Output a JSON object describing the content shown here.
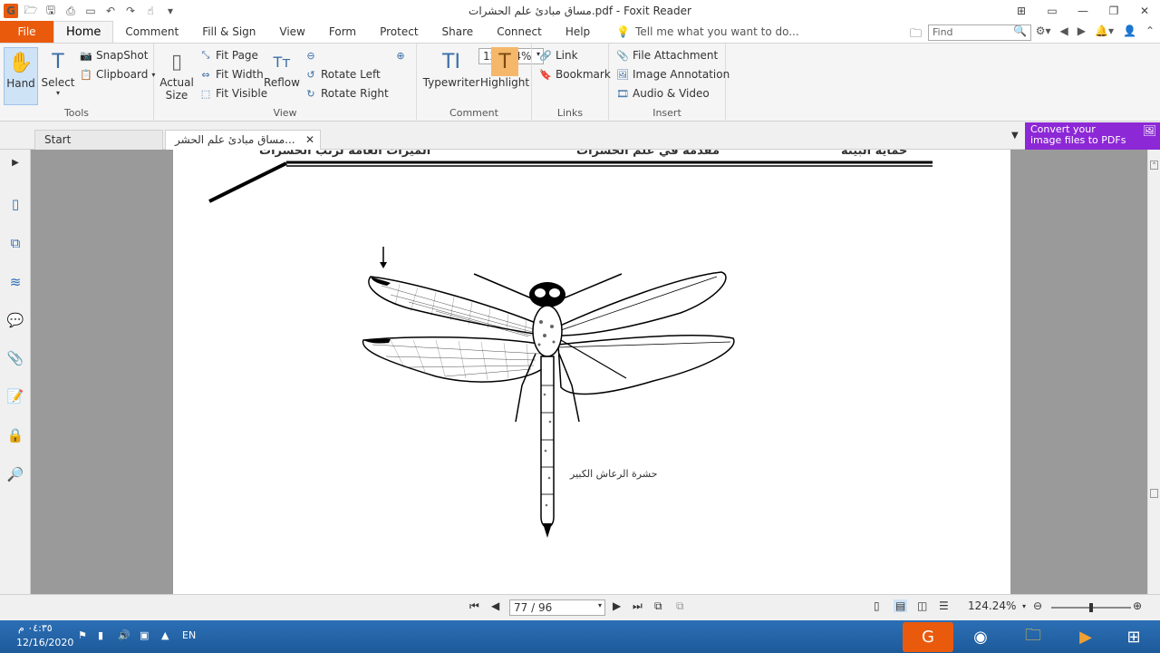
{
  "window": {
    "title": "مساق مبادئ علم الحشرات.pdf - Foxit Reader"
  },
  "menu": {
    "file": "File",
    "tabs": [
      "Home",
      "Comment",
      "Fill & Sign",
      "View",
      "Form",
      "Protect",
      "Share",
      "Connect",
      "Help"
    ],
    "tell_me": "Tell me what you want to do...",
    "find_placeholder": "Find"
  },
  "ribbon": {
    "tools": {
      "hand": "Hand",
      "select": "Select",
      "snapshot": "SnapShot",
      "clipboard": "Clipboard",
      "label": "Tools"
    },
    "view": {
      "actual_size_1": "Actual",
      "actual_size_2": "Size",
      "fit_page": "Fit Page",
      "fit_width": "Fit Width",
      "fit_visible": "Fit Visible",
      "reflow": "Reflow",
      "zoom": "124.24%",
      "rotate_left": "Rotate Left",
      "rotate_right": "Rotate Right",
      "label": "View"
    },
    "comment": {
      "typewriter": "Typewriter",
      "highlight": "Highlight",
      "label": "Comment"
    },
    "links": {
      "link": "Link",
      "bookmark": "Bookmark",
      "label": "Links"
    },
    "insert": {
      "file_attachment": "File Attachment",
      "image_annotation": "Image Annotation",
      "audio_video": "Audio & Video",
      "label": "Insert"
    }
  },
  "doc_tabs": {
    "start": "Start",
    "current": "مساق مبادئ علم الحشر..."
  },
  "banner": {
    "line1": "Convert your",
    "line2": "image files to PDFs"
  },
  "page_content": {
    "header_left": "الميزات العامة لرتب الحشرات",
    "header_center": "مقدمة في علم الحشرات",
    "header_right": "حماية البيئة",
    "caption": "حشرة الرعاش الكبير"
  },
  "statusbar": {
    "page": "77 / 96",
    "zoom": "124.24%"
  },
  "taskbar": {
    "lang": "EN",
    "time": "٠٤:٣٥ م",
    "date": "12/16/2020"
  }
}
